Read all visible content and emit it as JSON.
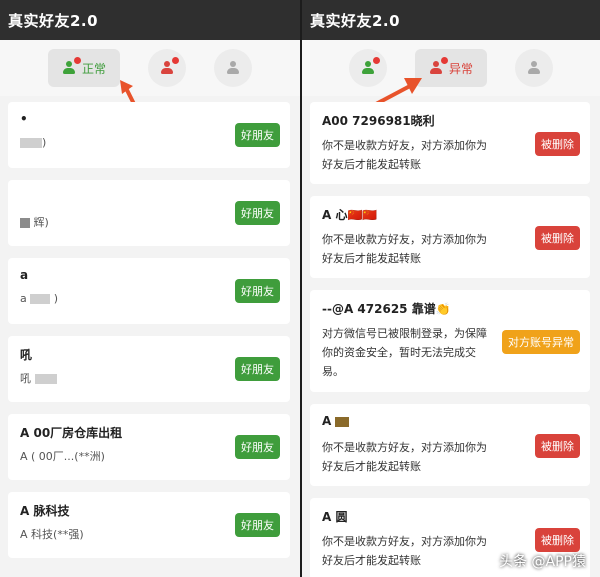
{
  "app_title": "真实好友2.0",
  "left": {
    "tab_label": "正常",
    "button_label": "好朋友",
    "cards": [
      {
        "name": "•",
        "sub": ")"
      },
      {
        "name": "",
        "sub": "辉)"
      },
      {
        "name": "a",
        "sub": "a"
      },
      {
        "name": "吼",
        "sub": "吼"
      },
      {
        "name": "A 00厂房仓库出租",
        "sub": "A ( 00厂...(**洲)"
      },
      {
        "name": "A 脉科技",
        "sub": "A 科技(**强)"
      }
    ]
  },
  "right": {
    "tab_label": "异常",
    "delete_label": "被删除",
    "abnormal_label": "对方账号异常",
    "not_friend_desc": "你不是收款方好友，对方添加你为好友后才能发起转账",
    "restricted_desc": "对方微信号已被限制登录，为保障你的资金安全，暂时无法完成交易。",
    "cards": [
      {
        "name": "A00 7296981晓利",
        "type": "deleted"
      },
      {
        "name": "A 心🇨🇳🇨🇳",
        "type": "deleted"
      },
      {
        "name": "--@A 472625 靠谱👏",
        "type": "restricted"
      },
      {
        "name": "A",
        "type": "deleted"
      },
      {
        "name": "A 圆",
        "type": "deleted"
      }
    ]
  },
  "watermark": "头条 @APP猿",
  "colors": {
    "green": "#3f9d3c",
    "red": "#d9433b",
    "orange": "#f0a21a",
    "topbar": "#2f2f2f"
  }
}
